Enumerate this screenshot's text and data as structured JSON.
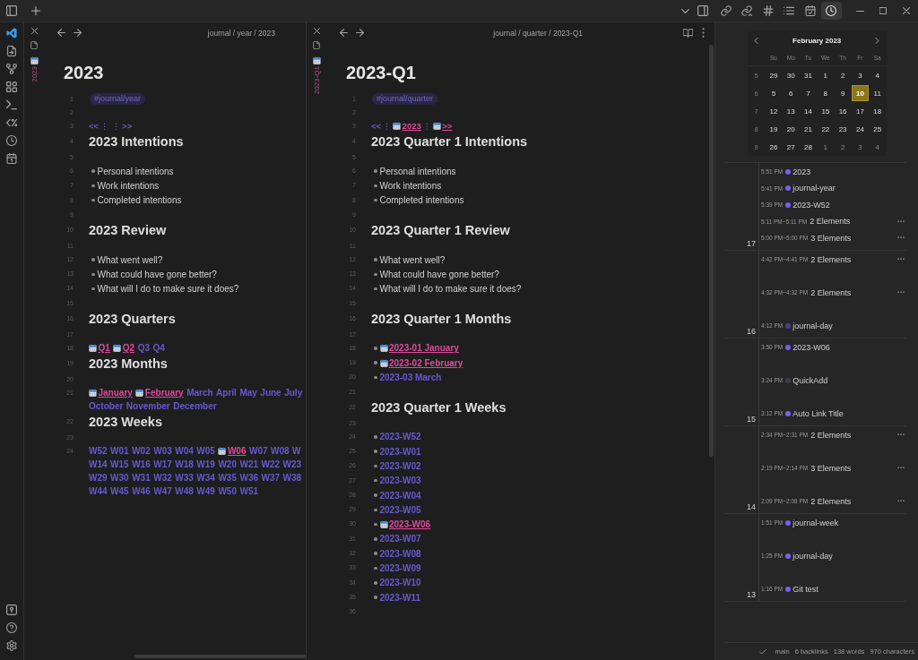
{
  "topbar": {
    "sidebar_tabs": [
      {
        "selected": false
      },
      {
        "selected": false
      },
      {
        "selected": false
      },
      {
        "selected": false
      },
      {
        "selected": false
      },
      {
        "selected": true
      }
    ]
  },
  "panes": [
    {
      "tab_title": "2023",
      "breadcrumb": "journal / year / 2023",
      "title": "2023",
      "lines": [
        {
          "number": "1",
          "kind": "tag",
          "text": "#journal/year"
        },
        {
          "number": "2",
          "kind": "blank"
        },
        {
          "number": "3",
          "kind": "nav",
          "items": [
            {
              "kind": "link",
              "text": "<<",
              "created": false
            },
            {
              "kind": "separator",
              "text": "⋮"
            },
            {
              "kind": "separator",
              "text": "⋮"
            },
            {
              "kind": "link",
              "text": ">>",
              "created": false
            }
          ]
        },
        {
          "number": "4",
          "kind": "heading",
          "text": "2023 Intentions"
        },
        {
          "number": "5",
          "kind": "blank"
        },
        {
          "number": "6",
          "kind": "bullet",
          "text": "Personal intentions"
        },
        {
          "number": "7",
          "kind": "bullet",
          "text": "Work intentions"
        },
        {
          "number": "8",
          "kind": "bullet",
          "text": "Completed intentions"
        },
        {
          "number": "9",
          "kind": "blank"
        },
        {
          "number": "10",
          "kind": "heading",
          "text": "2023 Review"
        },
        {
          "number": "11",
          "kind": "blank"
        },
        {
          "number": "12",
          "kind": "bullet",
          "text": "What went well?"
        },
        {
          "number": "13",
          "kind": "bullet",
          "text": "What could have gone better?"
        },
        {
          "number": "14",
          "kind": "bullet",
          "text": "What will I do to make sure it does?"
        },
        {
          "number": "15",
          "kind": "blank"
        },
        {
          "number": "16",
          "kind": "heading",
          "text": "2023 Quarters"
        },
        {
          "number": "17",
          "kind": "blank"
        },
        {
          "number": "18",
          "kind": "links",
          "rows": [
            [
              {
                "text": "Q1",
                "created": true
              },
              {
                "text": "Q2",
                "created": true
              },
              {
                "text": "Q3",
                "created": false
              },
              {
                "text": "Q4",
                "created": false
              }
            ]
          ]
        },
        {
          "number": "19",
          "kind": "heading",
          "text": "2023 Months"
        },
        {
          "number": "20",
          "kind": "blank"
        },
        {
          "number": "21",
          "kind": "links",
          "rows": [
            [
              {
                "text": "January",
                "created": true
              },
              {
                "text": "February",
                "created": true
              },
              {
                "text": "March",
                "created": false
              },
              {
                "text": "April",
                "created": false
              },
              {
                "text": "May",
                "created": false
              },
              {
                "text": "June",
                "created": false
              },
              {
                "text": "July",
                "created": false
              }
            ],
            [
              {
                "text": "October",
                "created": false
              },
              {
                "text": "November",
                "created": false
              },
              {
                "text": "December",
                "created": false
              }
            ]
          ]
        },
        {
          "number": "22",
          "kind": "heading",
          "text": "2023 Weeks"
        },
        {
          "number": "23",
          "kind": "blank"
        },
        {
          "number": "24",
          "kind": "links",
          "rows": [
            [
              {
                "text": "W52",
                "created": false
              },
              {
                "text": "W01",
                "created": false
              },
              {
                "text": "W02",
                "created": false
              },
              {
                "text": "W03",
                "created": false
              },
              {
                "text": "W04",
                "created": false
              },
              {
                "text": "W05",
                "created": false
              },
              {
                "text": "W06",
                "created": true
              },
              {
                "text": "W07",
                "created": false
              },
              {
                "text": "W08",
                "created": false
              },
              {
                "text": "W",
                "created": false
              }
            ],
            [
              {
                "text": "W14",
                "created": false
              },
              {
                "text": "W15",
                "created": false
              },
              {
                "text": "W16",
                "created": false
              },
              {
                "text": "W17",
                "created": false
              },
              {
                "text": "W18",
                "created": false
              },
              {
                "text": "W19",
                "created": false
              },
              {
                "text": "W20",
                "created": false
              },
              {
                "text": "W21",
                "created": false
              },
              {
                "text": "W22",
                "created": false
              },
              {
                "text": "W23",
                "created": false
              }
            ],
            [
              {
                "text": "W29",
                "created": false
              },
              {
                "text": "W30",
                "created": false
              },
              {
                "text": "W31",
                "created": false
              },
              {
                "text": "W32",
                "created": false
              },
              {
                "text": "W33",
                "created": false
              },
              {
                "text": "W34",
                "created": false
              },
              {
                "text": "W35",
                "created": false
              },
              {
                "text": "W36",
                "created": false
              },
              {
                "text": "W37",
                "created": false
              },
              {
                "text": "W38",
                "created": false
              }
            ],
            [
              {
                "text": "W44",
                "created": false
              },
              {
                "text": "W45",
                "created": false
              },
              {
                "text": "W46",
                "created": false
              },
              {
                "text": "W47",
                "created": false
              },
              {
                "text": "W48",
                "created": false
              },
              {
                "text": "W49",
                "created": false
              },
              {
                "text": "W50",
                "created": false
              },
              {
                "text": "W51",
                "created": false
              }
            ]
          ]
        }
      ]
    },
    {
      "tab_title": "2023-Q1",
      "breadcrumb": "journal / quarter / 2023-Q1",
      "title": "2023-Q1",
      "lines": [
        {
          "number": "1",
          "kind": "tag",
          "text": "#journal/quarter"
        },
        {
          "number": "2",
          "kind": "blank"
        },
        {
          "number": "3",
          "kind": "nav",
          "items": [
            {
              "kind": "link",
              "text": "<<",
              "created": false
            },
            {
              "kind": "separator",
              "text": "⋮"
            },
            {
              "kind": "link",
              "text": "2023",
              "created": true
            },
            {
              "kind": "separator",
              "text": "⋮"
            },
            {
              "kind": "link",
              "text": ">>",
              "created": true
            }
          ]
        },
        {
          "number": "4",
          "kind": "heading",
          "text": "2023 Quarter 1 Intentions"
        },
        {
          "number": "5",
          "kind": "blank"
        },
        {
          "number": "6",
          "kind": "bullet",
          "text": "Personal intentions"
        },
        {
          "number": "7",
          "kind": "bullet",
          "text": "Work intentions"
        },
        {
          "number": "8",
          "kind": "bullet",
          "text": "Completed intentions"
        },
        {
          "number": "9",
          "kind": "blank"
        },
        {
          "number": "10",
          "kind": "heading",
          "text": "2023 Quarter 1 Review"
        },
        {
          "number": "11",
          "kind": "blank"
        },
        {
          "number": "12",
          "kind": "bullet",
          "text": "What went well?"
        },
        {
          "number": "13",
          "kind": "bullet",
          "text": "What could have gone better?"
        },
        {
          "number": "14",
          "kind": "bullet",
          "text": "What will I do to make sure it does?"
        },
        {
          "number": "15",
          "kind": "blank"
        },
        {
          "number": "16",
          "kind": "heading",
          "text": "2023 Quarter 1 Months"
        },
        {
          "number": "17",
          "kind": "blank"
        },
        {
          "number": "18",
          "kind": "link_bullet",
          "link": {
            "text": "2023-01 January",
            "created": true
          }
        },
        {
          "number": "19",
          "kind": "link_bullet",
          "link": {
            "text": "2023-02 February",
            "created": true
          }
        },
        {
          "number": "20",
          "kind": "link_bullet",
          "link": {
            "text": "2023-03 March",
            "created": false
          }
        },
        {
          "number": "21",
          "kind": "blank"
        },
        {
          "number": "22",
          "kind": "heading",
          "text": "2023 Quarter 1 Weeks"
        },
        {
          "number": "23",
          "kind": "blank"
        },
        {
          "number": "24",
          "kind": "link_bullet",
          "link": {
            "text": "2023-W52",
            "created": false
          }
        },
        {
          "number": "25",
          "kind": "link_bullet",
          "link": {
            "text": "2023-W01",
            "created": false
          }
        },
        {
          "number": "26",
          "kind": "link_bullet",
          "link": {
            "text": "2023-W02",
            "created": false
          }
        },
        {
          "number": "27",
          "kind": "link_bullet",
          "link": {
            "text": "2023-W03",
            "created": false
          }
        },
        {
          "number": "28",
          "kind": "link_bullet",
          "link": {
            "text": "2023-W04",
            "created": false
          }
        },
        {
          "number": "29",
          "kind": "link_bullet",
          "link": {
            "text": "2023-W05",
            "created": false
          }
        },
        {
          "number": "30",
          "kind": "link_bullet",
          "link": {
            "text": "2023-W06",
            "created": true
          }
        },
        {
          "number": "31",
          "kind": "link_bullet",
          "link": {
            "text": "2023-W07",
            "created": false
          }
        },
        {
          "number": "32",
          "kind": "link_bullet",
          "link": {
            "text": "2023-W08",
            "created": false
          }
        },
        {
          "number": "33",
          "kind": "link_bullet",
          "link": {
            "text": "2023-W09",
            "created": false
          }
        },
        {
          "number": "34",
          "kind": "link_bullet",
          "link": {
            "text": "2023-W10",
            "created": false
          }
        },
        {
          "number": "35",
          "kind": "link_bullet",
          "link": {
            "text": "2023-W11",
            "created": false
          }
        },
        {
          "number": "36",
          "kind": "blank"
        }
      ]
    }
  ],
  "calendar": {
    "month": "February 2023",
    "weekdays": [
      "Su",
      "Mo",
      "Tu",
      "We",
      "Th",
      "Fr",
      "Sa"
    ],
    "weeks": [
      {
        "number": "5",
        "days": [
          {
            "label": "29",
            "selected": false,
            "faded": false
          },
          {
            "label": "30",
            "selected": false,
            "faded": false
          },
          {
            "label": "31",
            "selected": false,
            "faded": false
          },
          {
            "label": "1",
            "selected": false,
            "faded": false
          },
          {
            "label": "2",
            "selected": false,
            "faded": false
          },
          {
            "label": "3",
            "selected": false,
            "faded": false
          },
          {
            "label": "4",
            "selected": false,
            "faded": false
          }
        ]
      },
      {
        "number": "6",
        "days": [
          {
            "label": "5",
            "selected": false,
            "faded": false
          },
          {
            "label": "6",
            "selected": false,
            "faded": false
          },
          {
            "label": "7",
            "selected": false,
            "faded": false
          },
          {
            "label": "8",
            "selected": false,
            "faded": false
          },
          {
            "label": "9",
            "selected": false,
            "faded": false
          },
          {
            "label": "10",
            "selected": true,
            "faded": false
          },
          {
            "label": "11",
            "selected": false,
            "faded": false
          }
        ]
      },
      {
        "number": "7",
        "days": [
          {
            "label": "12",
            "selected": false,
            "faded": false
          },
          {
            "label": "13",
            "selected": false,
            "faded": false
          },
          {
            "label": "14",
            "selected": false,
            "faded": false
          },
          {
            "label": "15",
            "selected": false,
            "faded": false
          },
          {
            "label": "16",
            "selected": false,
            "faded": false
          },
          {
            "label": "17",
            "selected": false,
            "faded": false
          },
          {
            "label": "18",
            "selected": false,
            "faded": false
          }
        ]
      },
      {
        "number": "8",
        "days": [
          {
            "label": "19",
            "selected": false,
            "faded": false
          },
          {
            "label": "20",
            "selected": false,
            "faded": false
          },
          {
            "label": "21",
            "selected": false,
            "faded": false
          },
          {
            "label": "22",
            "selected": false,
            "faded": false
          },
          {
            "label": "23",
            "selected": false,
            "faded": false
          },
          {
            "label": "24",
            "selected": false,
            "faded": false
          },
          {
            "label": "25",
            "selected": false,
            "faded": false
          }
        ]
      },
      {
        "number": "9",
        "days": [
          {
            "label": "26",
            "selected": false,
            "faded": false
          },
          {
            "label": "27",
            "selected": false,
            "faded": false
          },
          {
            "label": "28",
            "selected": false,
            "faded": false
          },
          {
            "label": "1",
            "selected": false,
            "faded": true
          },
          {
            "label": "2",
            "selected": false,
            "faded": true
          },
          {
            "label": "3",
            "selected": false,
            "faded": true
          },
          {
            "label": "4",
            "selected": false,
            "faded": true
          }
        ]
      }
    ]
  },
  "timeline": [
    {
      "hour": "17",
      "entries": [
        {
          "kind": "note",
          "time": "5:51 PM",
          "title": "2023",
          "color": "#7c5cff"
        },
        {
          "kind": "note",
          "time": "5:41 PM",
          "title": "journal-year",
          "color": "#7c5cff"
        },
        {
          "kind": "note",
          "time": "5:39 PM",
          "title": "2023-W52",
          "color": "#7c5cff"
        },
        {
          "kind": "group",
          "time": "5:11 PM~5:11 PM",
          "title": "2 Elements"
        },
        {
          "kind": "group",
          "time": "5:00 PM~5:00 PM",
          "title": "3 Elements"
        }
      ]
    },
    {
      "hour": "16",
      "entries": [
        {
          "kind": "group",
          "time": "4:42 PM~4:41 PM",
          "title": "2 Elements"
        },
        {
          "kind": "group",
          "time": "4:32 PM~4:32 PM",
          "title": "2 Elements"
        },
        {
          "kind": "note",
          "time": "4:12 PM",
          "title": "journal-day",
          "color": "#4a3d8f"
        }
      ]
    },
    {
      "hour": "15",
      "entries": [
        {
          "kind": "note",
          "time": "3:50 PM",
          "title": "2023-W06",
          "color": "#7c5cff"
        },
        {
          "kind": "note",
          "time": "3:24 PM",
          "title": "QuickAdd",
          "color": "#3d3b4a"
        },
        {
          "kind": "note",
          "time": "3:12 PM",
          "title": "Auto Link Title",
          "color": "#7c5cff"
        }
      ]
    },
    {
      "hour": "14",
      "entries": [
        {
          "kind": "group",
          "time": "2:34 PM~2:31 PM",
          "title": "2 Elements"
        },
        {
          "kind": "group",
          "time": "2:19 PM~2:14 PM",
          "title": "3 Elements"
        },
        {
          "kind": "group",
          "time": "2:09 PM~2:08 PM",
          "title": "2 Elements"
        }
      ]
    },
    {
      "hour": "13",
      "entries": [
        {
          "kind": "note",
          "time": "1:51 PM",
          "title": "journal-week",
          "color": "#7c5cff"
        },
        {
          "kind": "note",
          "time": "1:25 PM",
          "title": "journal-day",
          "color": "#7c5cff"
        },
        {
          "kind": "note",
          "time": "1:16 PM",
          "title": "Git test",
          "color": "#7c5cff"
        }
      ]
    }
  ],
  "status_bar": {
    "items": [
      "main",
      "6 backlinks",
      "138 words",
      "970 characters"
    ]
  }
}
